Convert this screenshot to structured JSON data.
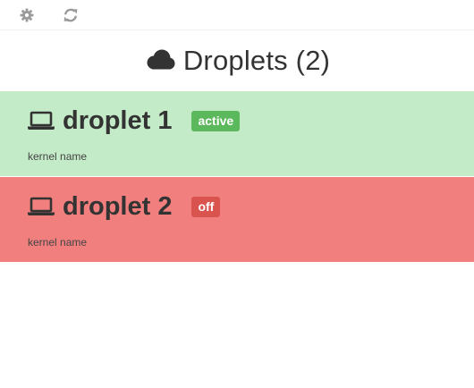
{
  "toolbar": {
    "settings_icon": "gear-icon",
    "refresh_icon": "refresh-icon"
  },
  "header": {
    "icon": "cloud-icon",
    "title": "Droplets (2)"
  },
  "droplets": [
    {
      "icon": "laptop-icon",
      "name": "droplet 1",
      "status": "active",
      "kernel": "kernel name",
      "row_color": "#c4ebc8",
      "badge_color": "#5cb85c"
    },
    {
      "icon": "laptop-icon",
      "name": "droplet 2",
      "status": "off",
      "kernel": "kernel name",
      "row_color": "#f07f7e",
      "badge_color": "#d9534f"
    }
  ]
}
